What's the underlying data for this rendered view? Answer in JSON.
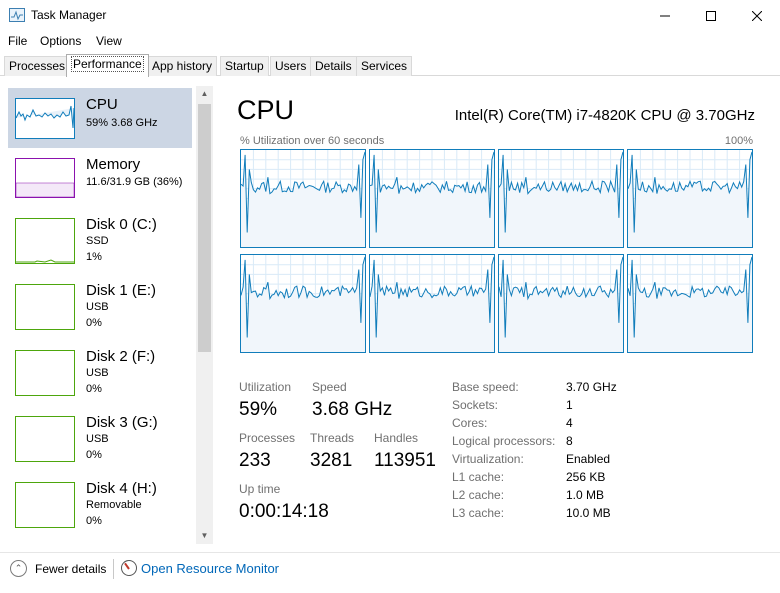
{
  "window": {
    "title": "Task Manager",
    "icon": "task-manager-icon",
    "controls": [
      "minimize",
      "maximize",
      "close"
    ]
  },
  "menu": [
    "File",
    "Options",
    "View"
  ],
  "tabs": [
    "Processes",
    "Performance",
    "App history",
    "Startup",
    "Users",
    "Details",
    "Services"
  ],
  "active_tab": "Performance",
  "sidebar": {
    "cpu": {
      "name": "CPU",
      "sub1": "59%  3.68 GHz"
    },
    "memory": {
      "name": "Memory",
      "sub1": "11.6/31.9 GB (36%)",
      "used_fraction": 0.36
    },
    "disk0": {
      "name": "Disk 0 (C:)",
      "sub1": "SSD",
      "sub2": "1%"
    },
    "disk1": {
      "name": "Disk 1 (E:)",
      "sub1": "USB",
      "sub2": "0%"
    },
    "disk2": {
      "name": "Disk 2 (F:)",
      "sub1": "USB",
      "sub2": "0%"
    },
    "disk3": {
      "name": "Disk 3 (G:)",
      "sub1": "USB",
      "sub2": "0%"
    },
    "disk4": {
      "name": "Disk 4 (H:)",
      "sub1": "Removable",
      "sub2": "0%"
    }
  },
  "main": {
    "title": "CPU",
    "model": "Intel(R) Core(TM) i7-4820K CPU @ 3.70GHz",
    "graph_caption": "% Utilization over 60 seconds",
    "graph_max": "100%",
    "core_count": 8
  },
  "stats": {
    "utilization_label": "Utilization",
    "utilization": "59%",
    "speed_label": "Speed",
    "speed": "3.68 GHz",
    "processes_label": "Processes",
    "processes": "233",
    "threads_label": "Threads",
    "threads": "3281",
    "handles_label": "Handles",
    "handles": "113951",
    "uptime_label": "Up time",
    "uptime": "0:00:14:18"
  },
  "specs": [
    {
      "label": "Base speed:",
      "value": "3.70 GHz"
    },
    {
      "label": "Sockets:",
      "value": "1"
    },
    {
      "label": "Cores:",
      "value": "4"
    },
    {
      "label": "Logical processors:",
      "value": "8"
    },
    {
      "label": "Virtualization:",
      "value": "Enabled"
    },
    {
      "label": "L1 cache:",
      "value": "256 KB"
    },
    {
      "label": "L2 cache:",
      "value": "1.0 MB"
    },
    {
      "label": "L3 cache:",
      "value": "10.0 MB"
    }
  ],
  "footer": {
    "fewer_details": "Fewer details",
    "resource_monitor": "Open Resource Monitor"
  },
  "colors": {
    "cpu": "#117dbb",
    "memory": "#8b12ae",
    "disk": "#4da60c",
    "selected": "#ccd6e4",
    "link": "#0067b8"
  }
}
